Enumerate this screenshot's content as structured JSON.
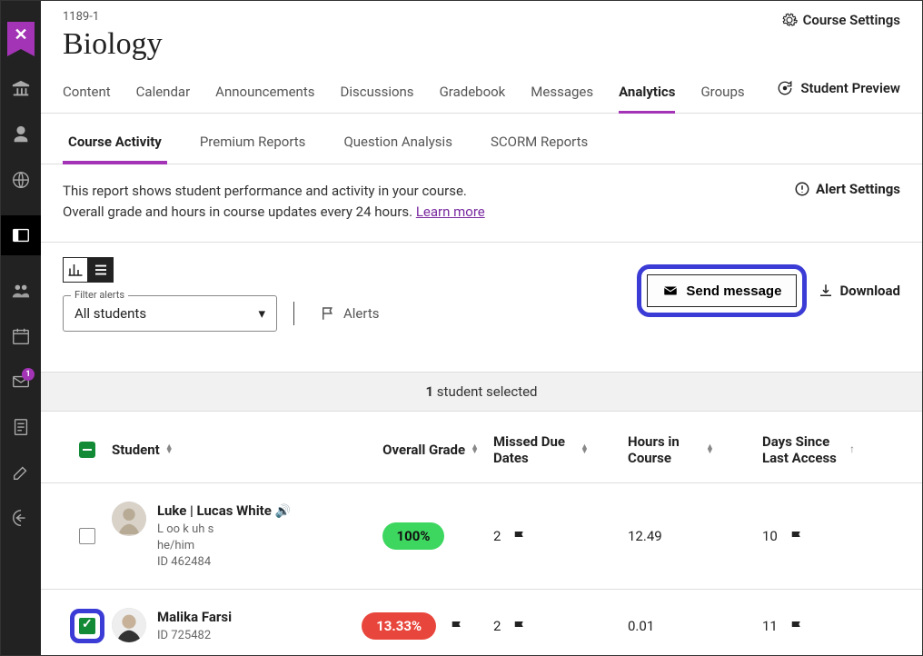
{
  "course": {
    "id": "1189-1",
    "title": "Biology"
  },
  "header": {
    "settings": "Course Settings",
    "preview": "Student Preview"
  },
  "nav": {
    "tabs": [
      "Content",
      "Calendar",
      "Announcements",
      "Discussions",
      "Gradebook",
      "Messages",
      "Analytics",
      "Groups"
    ],
    "active": 6
  },
  "subnav": {
    "tabs": [
      "Course Activity",
      "Premium Reports",
      "Question Analysis",
      "SCORM Reports"
    ],
    "active": 0
  },
  "description": {
    "line1": "This report shows student performance and activity in your course.",
    "line2_prefix": "Overall grade and hours in course updates every 24 hours. ",
    "learn_more": "Learn more",
    "alert_settings": "Alert Settings"
  },
  "toolbar": {
    "filter_legend": "Filter alerts",
    "filter_value": "All students",
    "alerts_label": "Alerts",
    "send_message": "Send message",
    "download": "Download"
  },
  "selection": {
    "count": "1",
    "label": " student selected"
  },
  "columns": {
    "student": "Student",
    "grade": "Overall Grade",
    "missed": "Missed Due Dates",
    "hours": "Hours in Course",
    "days": "Days Since Last Access"
  },
  "rows": [
    {
      "selected": false,
      "name": "Luke | Lucas White",
      "has_audio": true,
      "phonetic": "L oo k uh s",
      "pronouns": "he/him",
      "id": "ID 462484",
      "grade": "100%",
      "grade_color": "green",
      "grade_flag": false,
      "missed": "2",
      "missed_flag": true,
      "hours": "12.49",
      "days": "10",
      "days_flag": true
    },
    {
      "selected": true,
      "highlight_cb": true,
      "name": "Malika Farsi",
      "has_audio": false,
      "phonetic": "",
      "pronouns": "",
      "id": "ID 725482",
      "grade": "13.33%",
      "grade_color": "red",
      "grade_flag": true,
      "missed": "2",
      "missed_flag": true,
      "hours": "0.01",
      "days": "11",
      "days_flag": true
    }
  ],
  "rail_badge": "1"
}
